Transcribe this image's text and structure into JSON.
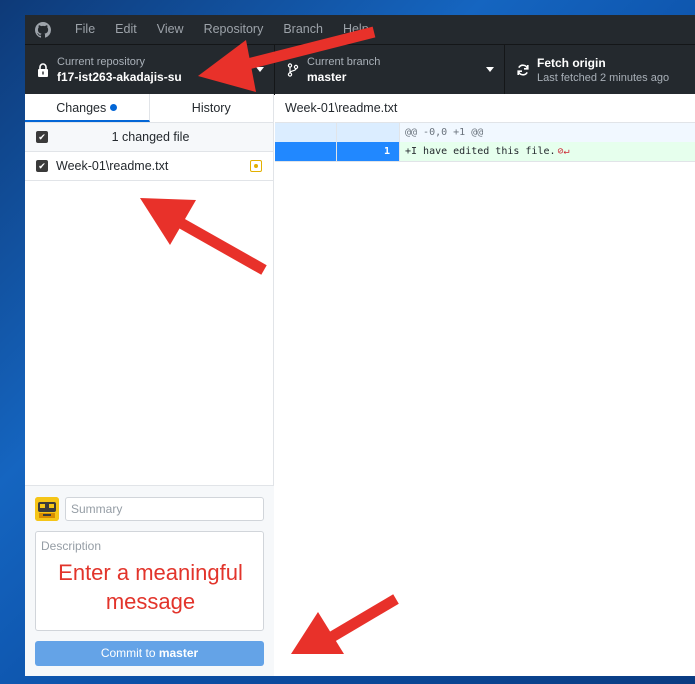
{
  "menu": {
    "items": [
      "File",
      "Edit",
      "View",
      "Repository",
      "Branch",
      "Help"
    ]
  },
  "toolbar": {
    "repo_label": "Current repository",
    "repo_value": "f17-ist263-akadajis-su",
    "branch_label": "Current branch",
    "branch_value": "master",
    "fetch_label": "Fetch origin",
    "fetch_sub": "Last fetched 2 minutes ago"
  },
  "sidebar": {
    "tabs": [
      {
        "label": "Changes",
        "active": true
      },
      {
        "label": "History",
        "active": false
      }
    ],
    "changes_count": "1 changed file",
    "files": [
      {
        "name": "Week-01\\readme.txt",
        "status": "modified"
      }
    ]
  },
  "commit": {
    "summary_placeholder": "Summary",
    "description_label": "Description",
    "description_text": "Enter a meaningful message",
    "button_prefix": "Commit to ",
    "button_branch": "master"
  },
  "diff": {
    "file_path": "Week-01\\readme.txt",
    "hunk_header": "@@ -0,0 +1 @@",
    "lines": [
      {
        "old": "",
        "new": "1",
        "text": "+I have edited this file."
      }
    ]
  },
  "colors": {
    "annotation_arrow": "#e8312a",
    "accent": "#0366d6",
    "commit_button": "#64a3e7",
    "modified": "#e3b000"
  },
  "icons": [
    "github-logo-icon",
    "lock-icon",
    "branch-icon",
    "sync-icon",
    "checkbox-icon",
    "modified-icon",
    "no-newline-icon"
  ]
}
